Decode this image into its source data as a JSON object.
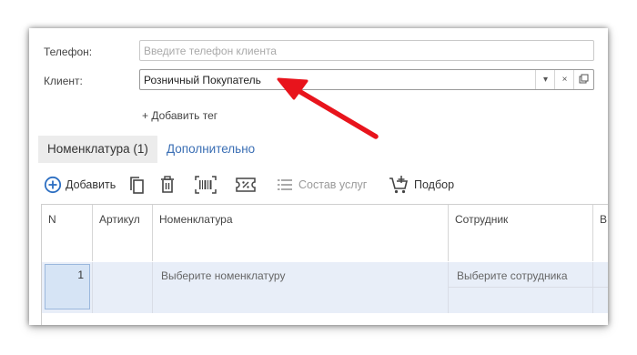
{
  "form": {
    "phone_label": "Телефон:",
    "phone_placeholder": "Введите телефон клиента",
    "client_label": "Клиент:",
    "client_value": "Розничный Покупатель",
    "client_buttons": [
      "dropdown-arrow",
      "clear",
      "open"
    ],
    "add_tag": "+ Добавить тег"
  },
  "tabs": [
    {
      "label": "Номенклатура (1)",
      "active": true
    },
    {
      "label": "Дополнительно",
      "active": false
    }
  ],
  "toolbar": {
    "add_label": "Добавить",
    "services_label": "Состав услуг",
    "pick_label": "Подбор",
    "icons": [
      "plus-circle-icon",
      "copy-icon",
      "delete-icon",
      "barcode-icon",
      "coupon-icon",
      "list-icon",
      "cart-icon"
    ]
  },
  "table": {
    "headers": [
      "N",
      "Артикул",
      "Номенклатура",
      "Сотрудник",
      "В"
    ],
    "row": {
      "n": "1",
      "article": "",
      "item": "Выберите номенклатуру",
      "employee": "Выберите сотрудника"
    }
  },
  "colors": {
    "accent": "#3a6eb4",
    "arrow": "#e8141c",
    "row_selected": "#e8eef8"
  }
}
